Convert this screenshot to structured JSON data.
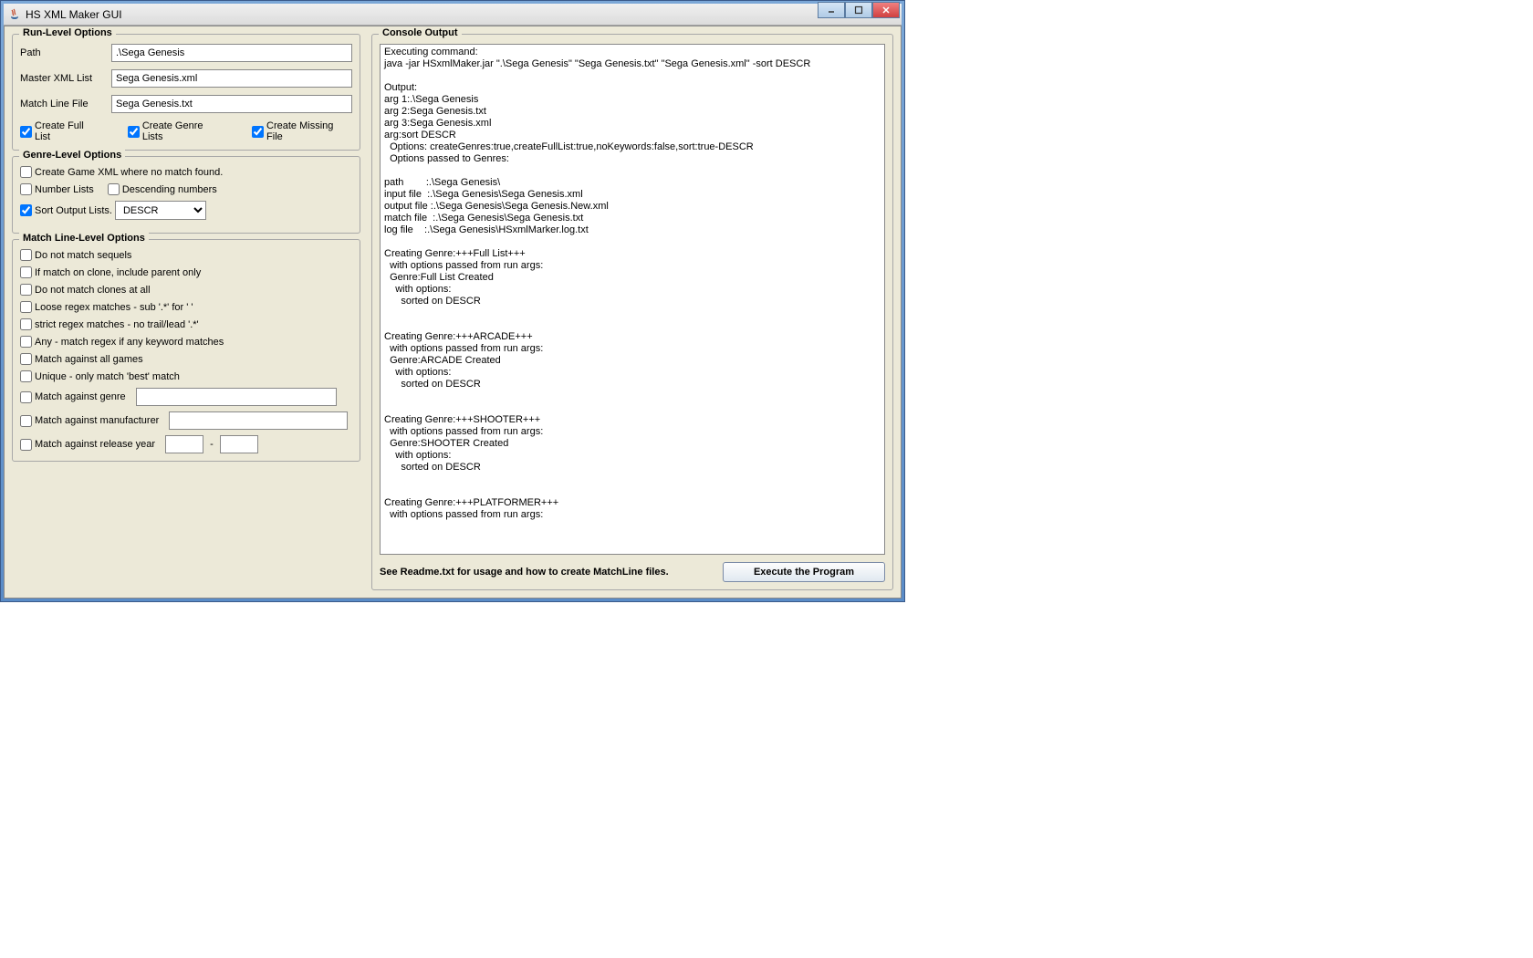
{
  "window": {
    "title": "HS XML Maker GUI"
  },
  "runLevel": {
    "legend": "Run-Level Options",
    "pathLabel": "Path",
    "pathValue": ".\\Sega Genesis",
    "masterLabel": "Master XML List",
    "masterValue": "Sega Genesis.xml",
    "matchLineLabel": "Match Line File",
    "matchLineValue": "Sega Genesis.txt",
    "createFullList": "Create Full List",
    "createGenreLists": "Create Genre Lists",
    "createMissingFile": "Create Missing File"
  },
  "genreLevel": {
    "legend": "Genre-Level Options",
    "createGameXml": "Create Game XML where no match found.",
    "numberLists": "Number Lists",
    "descendingNumbers": "Descending numbers",
    "sortOutputLists": "Sort Output Lists.",
    "sortValue": "DESCR"
  },
  "matchLevel": {
    "legend": "Match Line-Level Options",
    "noSequels": "Do not match sequels",
    "cloneParent": "If match on clone, include parent only",
    "noClones": "Do not match clones at all",
    "looseRegex": "Loose regex matches - sub '.*' for ' '",
    "strictRegex": "strict regex matches - no trail/lead '.*'",
    "anyMatch": "Any - match regex if any keyword matches",
    "allGames": "Match against all games",
    "uniqueBest": "Unique - only match 'best' match",
    "matchGenre": "Match against genre",
    "matchManufacturer": "Match against manufacturer",
    "matchYear": "Match against release year",
    "yearSep": "-"
  },
  "console": {
    "legend": "Console Output",
    "text": "Executing command:\njava -jar HSxmlMaker.jar \".\\Sega Genesis\" \"Sega Genesis.txt\" \"Sega Genesis.xml\" -sort DESCR\n\nOutput:\narg 1:.\\Sega Genesis\narg 2:Sega Genesis.txt\narg 3:Sega Genesis.xml\narg:sort DESCR\n  Options: createGenres:true,createFullList:true,noKeywords:false,sort:true-DESCR\n  Options passed to Genres:\n\npath        :.\\Sega Genesis\\\ninput file  :.\\Sega Genesis\\Sega Genesis.xml\noutput file :.\\Sega Genesis\\Sega Genesis.New.xml\nmatch file  :.\\Sega Genesis\\Sega Genesis.txt\nlog file    :.\\Sega Genesis\\HSxmlMarker.log.txt\n\nCreating Genre:+++Full List+++\n  with options passed from run args:\n  Genre:Full List Created\n    with options:\n      sorted on DESCR\n\n\nCreating Genre:+++ARCADE+++\n  with options passed from run args:\n  Genre:ARCADE Created\n    with options:\n      sorted on DESCR\n\n\nCreating Genre:+++SHOOTER+++\n  with options passed from run args:\n  Genre:SHOOTER Created\n    with options:\n      sorted on DESCR\n\n\nCreating Genre:+++PLATFORMER+++\n  with options passed from run args:"
  },
  "footer": {
    "readme": "See Readme.txt for usage and how to create MatchLine files.",
    "execute": "Execute the Program"
  }
}
